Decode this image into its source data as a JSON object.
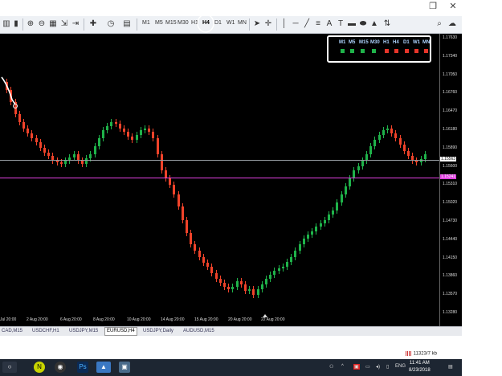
{
  "window": {
    "restore_symbol": "❐",
    "close_symbol": "✕"
  },
  "toolbar": {
    "timeframes": [
      "M1",
      "M5",
      "M15",
      "M30",
      "H1",
      "H4",
      "D1",
      "W1",
      "MN"
    ],
    "active_timeframe": "H4"
  },
  "chart": {
    "price_ticks": [
      "1.17630",
      "1.17340",
      "1.17050",
      "1.16760",
      "1.16470",
      "1.16180",
      "1.15890",
      "1.15600",
      "1.15310",
      "1.15020",
      "1.14730",
      "1.14440",
      "1.14150",
      "1.13860",
      "1.13570",
      "1.13280",
      "1.12990"
    ],
    "current_price": "1.15563",
    "magenta_price": "1.15241",
    "time_labels": [
      "Jul 20:00",
      "2 Aug 20:00",
      "6 Aug 20:00",
      "8 Aug 20:00",
      "10 Aug 20:00",
      "14 Aug 20:00",
      "15 Aug 20:00",
      "20 Aug 20:00",
      "22 Aug 20:00"
    ],
    "colors": {
      "bull": "#1fb34a",
      "bear": "#f0432a",
      "magenta_line": "#e040e0",
      "price_line": "#9aa0a6"
    }
  },
  "mtf_panel": {
    "labels": [
      "M1",
      "M5",
      "M15",
      "M30",
      "H1",
      "H4",
      "D1",
      "W1",
      "MN"
    ],
    "states": [
      "green",
      "green",
      "green",
      "green",
      "red",
      "red",
      "red",
      "red",
      "red"
    ]
  },
  "tabs": [
    "CAD,M15",
    "USDCHF,H1",
    "USDJPY,M15",
    "EURUSD,H4",
    "USDJPY,Daily",
    "AUDUSD,M15"
  ],
  "active_tab": "EURUSD,H4",
  "status": {
    "memory": "11323/7 kb"
  },
  "taskbar": {
    "language": "ENG",
    "time": "11:41 AM",
    "date": "8/23/2018"
  }
}
